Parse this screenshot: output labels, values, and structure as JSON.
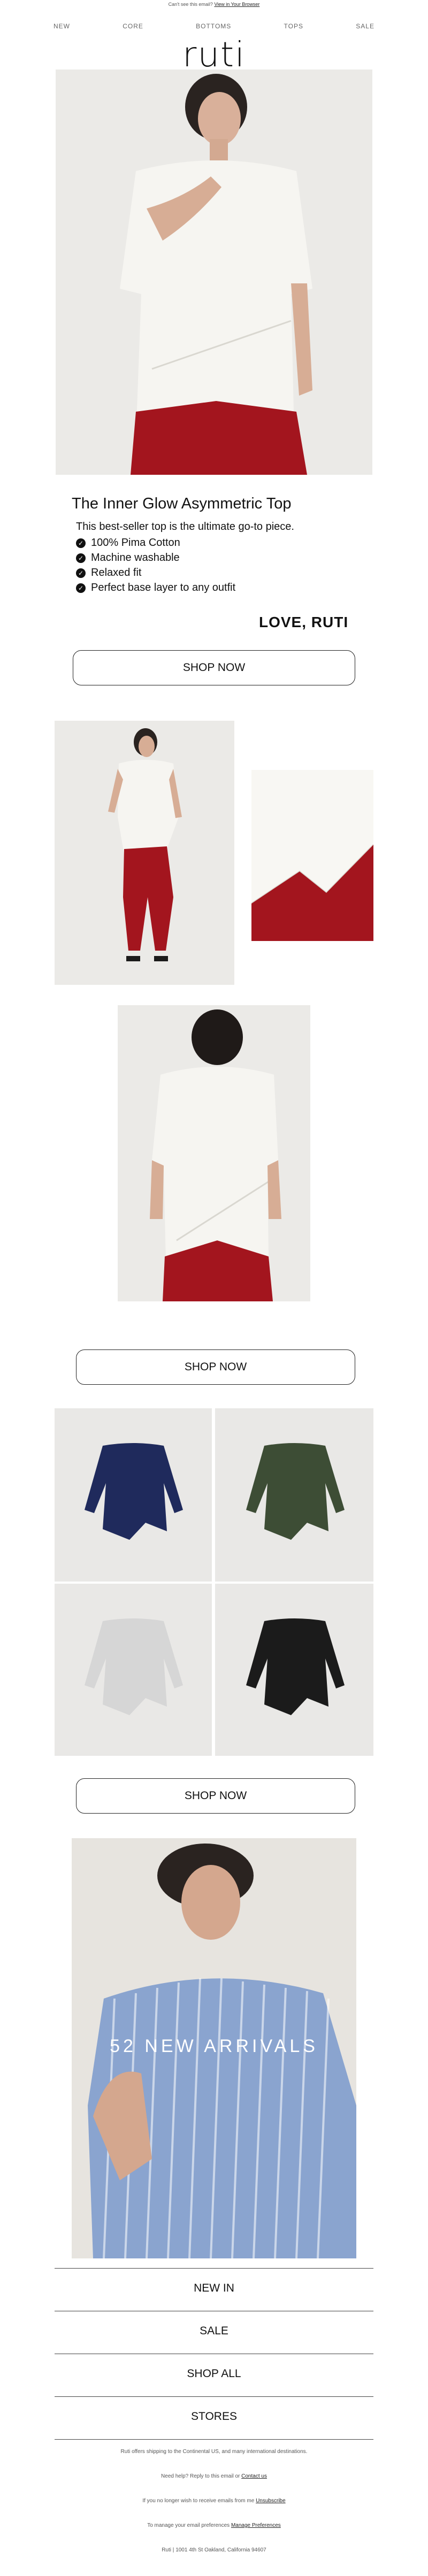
{
  "preheader": {
    "text": "Can't see this email?",
    "link": "View in Your Browser"
  },
  "nav": [
    "NEW",
    "CORE",
    "BOTTOMS",
    "TOPS",
    "SALE"
  ],
  "logo": "ruti",
  "product": {
    "title": "The Inner Glow Asymmetric Top",
    "intro": "This best-seller top is the ultimate go-to piece.",
    "features": [
      "100% Pima Cotton",
      "Machine washable",
      "Relaxed fit",
      "Perfect base layer to any outfit"
    ],
    "signoff": "LOVE, RUTI"
  },
  "buttons": {
    "shop_now_1": "SHOP NOW",
    "shop_now_2": "SHOP NOW",
    "shop_now_3": "SHOP NOW"
  },
  "banner": {
    "text": "52 NEW ARRIVALS"
  },
  "footer_links": [
    "NEW IN",
    "SALE",
    "SHOP ALL",
    "STORES"
  ],
  "footer": {
    "shipping": "Ruti offers shipping to the Continental US, and many international destinations.",
    "help_text": "Need help? Reply to this email or",
    "help_link": "Contact us",
    "unsub_text": "If you no longer wish to receive emails from me",
    "unsub_link": "Unsubscribe",
    "manage_text": "To manage your email preferences",
    "manage_link": "Manage Preferences",
    "address": "Ruti | 1001 4th St Oakland, California 94607"
  },
  "colors": {
    "navy": "#1f2a5c",
    "olive": "#3d4d35",
    "light_grey": "#d6d6d6",
    "black": "#1b1b1b",
    "pants_red": "#a3151e",
    "shirt_blue": "#8aa4cf"
  }
}
